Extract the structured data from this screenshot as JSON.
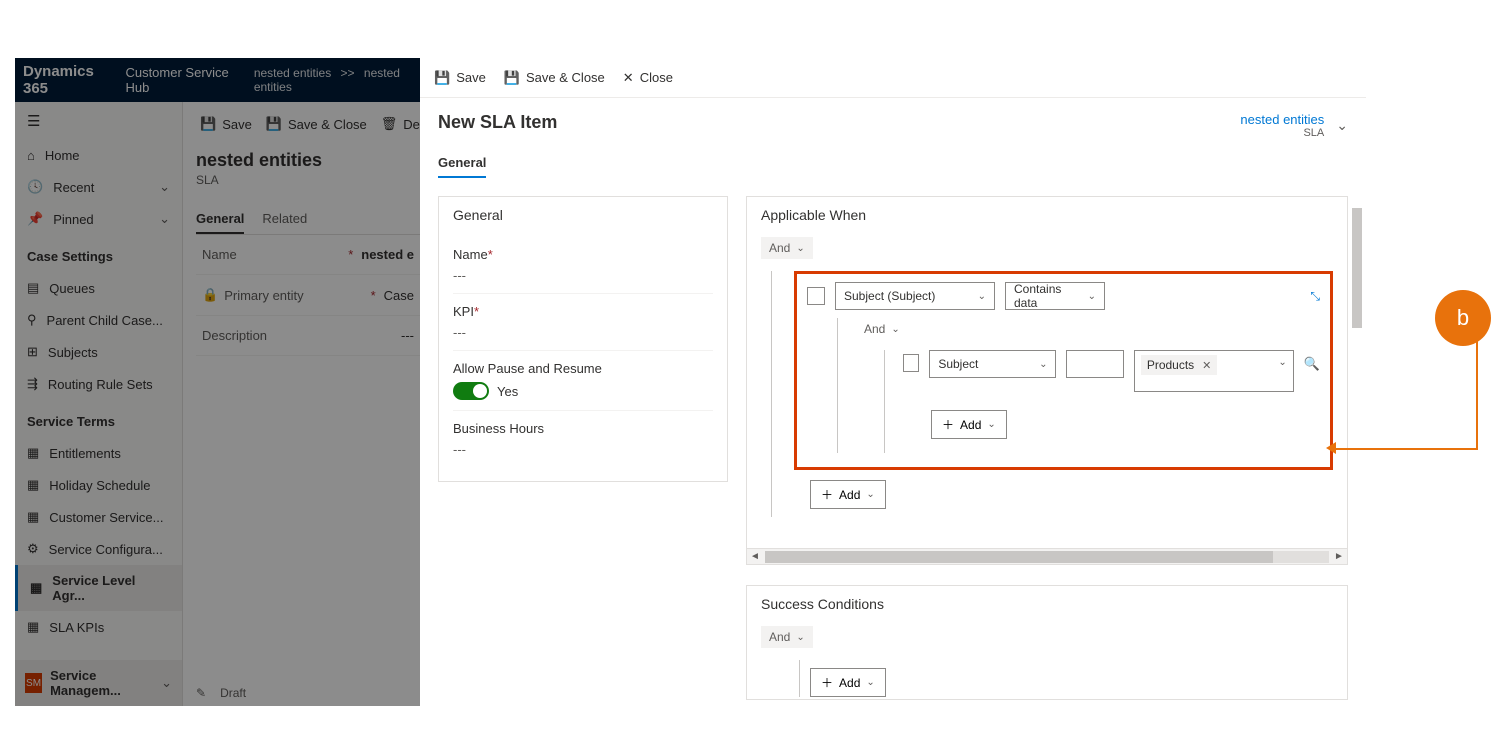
{
  "bg": {
    "brand": "Dynamics 365",
    "hub": "Customer Service Hub",
    "breadcrumb1": "nested entities",
    "breadcrumb_sep": ">>",
    "breadcrumb2": "nested entities",
    "cmdbar": {
      "save": "Save",
      "saveclose": "Save & Close",
      "delete": "Delete"
    },
    "sidebar": {
      "home": "Home",
      "recent": "Recent",
      "pinned": "Pinned",
      "sec_case": "Case Settings",
      "queues": "Queues",
      "parentchild": "Parent Child Case...",
      "subjects": "Subjects",
      "routing": "Routing Rule Sets",
      "sec_service": "Service Terms",
      "entitlements": "Entitlements",
      "holiday": "Holiday Schedule",
      "custsvc": "Customer Service...",
      "svcconfig": "Service Configura...",
      "sla": "Service Level Agr...",
      "slakpi": "SLA KPIs",
      "footer_badge": "SM",
      "footer_text": "Service Managem..."
    },
    "body": {
      "title": "nested entities",
      "subtitle": "SLA",
      "tab_general": "General",
      "tab_related": "Related",
      "name_label": "Name",
      "name_val": "nested e",
      "primary_label": "Primary entity",
      "primary_val": "Case",
      "desc_label": "Description",
      "desc_val": "---"
    },
    "status": {
      "draft": "Draft"
    }
  },
  "fg": {
    "cmdbar": {
      "save": "Save",
      "saveclose": "Save & Close",
      "close": "Close"
    },
    "title": "New SLA Item",
    "head_link": "nested entities",
    "head_sub": "SLA",
    "tab_general": "General",
    "general_card": {
      "title": "General",
      "name_label": "Name",
      "name_val": "---",
      "kpi_label": "KPI",
      "kpi_val": "---",
      "allow_label": "Allow Pause and Resume",
      "allow_val": "Yes",
      "bh_label": "Business Hours",
      "bh_val": "---"
    },
    "applicable": {
      "title": "Applicable When",
      "and": "And",
      "field1": "Subject (Subject)",
      "op1": "Contains data",
      "nested_and": "And",
      "field2": "Subject",
      "tag": "Products",
      "add": "Add"
    },
    "success": {
      "title": "Success Conditions",
      "and": "And",
      "add": "Add"
    }
  },
  "annotation": {
    "label": "b"
  }
}
